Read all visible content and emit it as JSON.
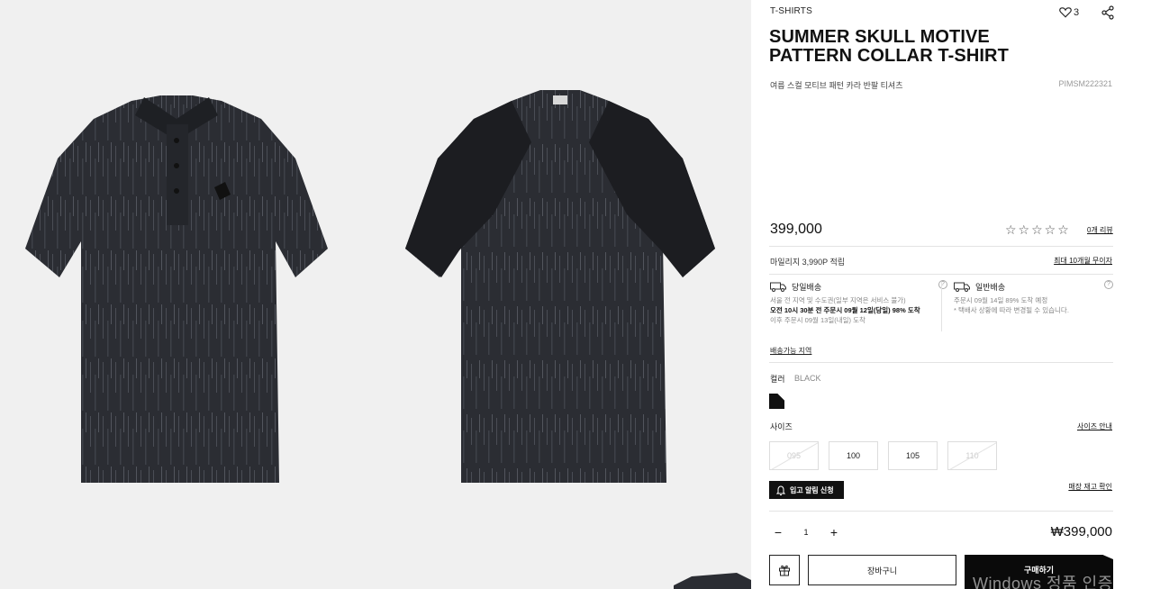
{
  "gallery": {
    "front_alt": "front",
    "back_alt": "back"
  },
  "product": {
    "category": "T-SHIRTS",
    "wish_count": "3",
    "title_line1": "SUMMER SKULL MOTIVE",
    "title_line2": "PATTERN COLLAR T-SHIRT",
    "subtitle": "여름 스컬 모티브 패턴 카라 반팔 티셔츠",
    "code": "PIMSM222321",
    "price": "399,000",
    "stars": "☆☆☆☆☆",
    "rating": 0,
    "reviews_link": "0개 리뷰"
  },
  "benefits": {
    "mileage": "마일리지 3,990P 적립",
    "installment_link": "최대 10개월 무이자"
  },
  "shipping": {
    "same_day": {
      "title": "당일배송",
      "line1": "서울 전 지역 및 수도권(일부 지역은 서비스 불가)",
      "line2": "오전 10시 30분 전 주문시 09월 12일(당일) 98% 도착",
      "line3": "이후 주문시 09월 13일(내일) 도착"
    },
    "standard": {
      "title": "일반배송",
      "line1": "주문시 09월 14일 89% 도착 예정",
      "line2": "* 택배사 상황에 따라 변경될 수 있습니다."
    },
    "help": "?",
    "area_link": "배송가능 지역"
  },
  "color": {
    "label": "컬러",
    "value": "BLACK",
    "swatch_color": "#111111"
  },
  "size": {
    "label": "사이즈",
    "guide_link": "사이즈 안내",
    "options": [
      {
        "label": "095",
        "available": false
      },
      {
        "label": "100",
        "available": true
      },
      {
        "label": "105",
        "available": true
      },
      {
        "label": "110",
        "available": false
      }
    ]
  },
  "restock": {
    "button": "입고 알림 신청",
    "stock_link": "매장 재고 확인"
  },
  "quantity": {
    "minus": "−",
    "value": "1",
    "plus": "+"
  },
  "total_price": "₩399,000",
  "actions": {
    "cart": "장바구니",
    "buy": "구매하기"
  },
  "watermark": "Windows 정품 인증",
  "colors": {
    "accent": "#111111",
    "gallery_bg": "#f0f0f0",
    "divider": "#e3e3e3"
  }
}
